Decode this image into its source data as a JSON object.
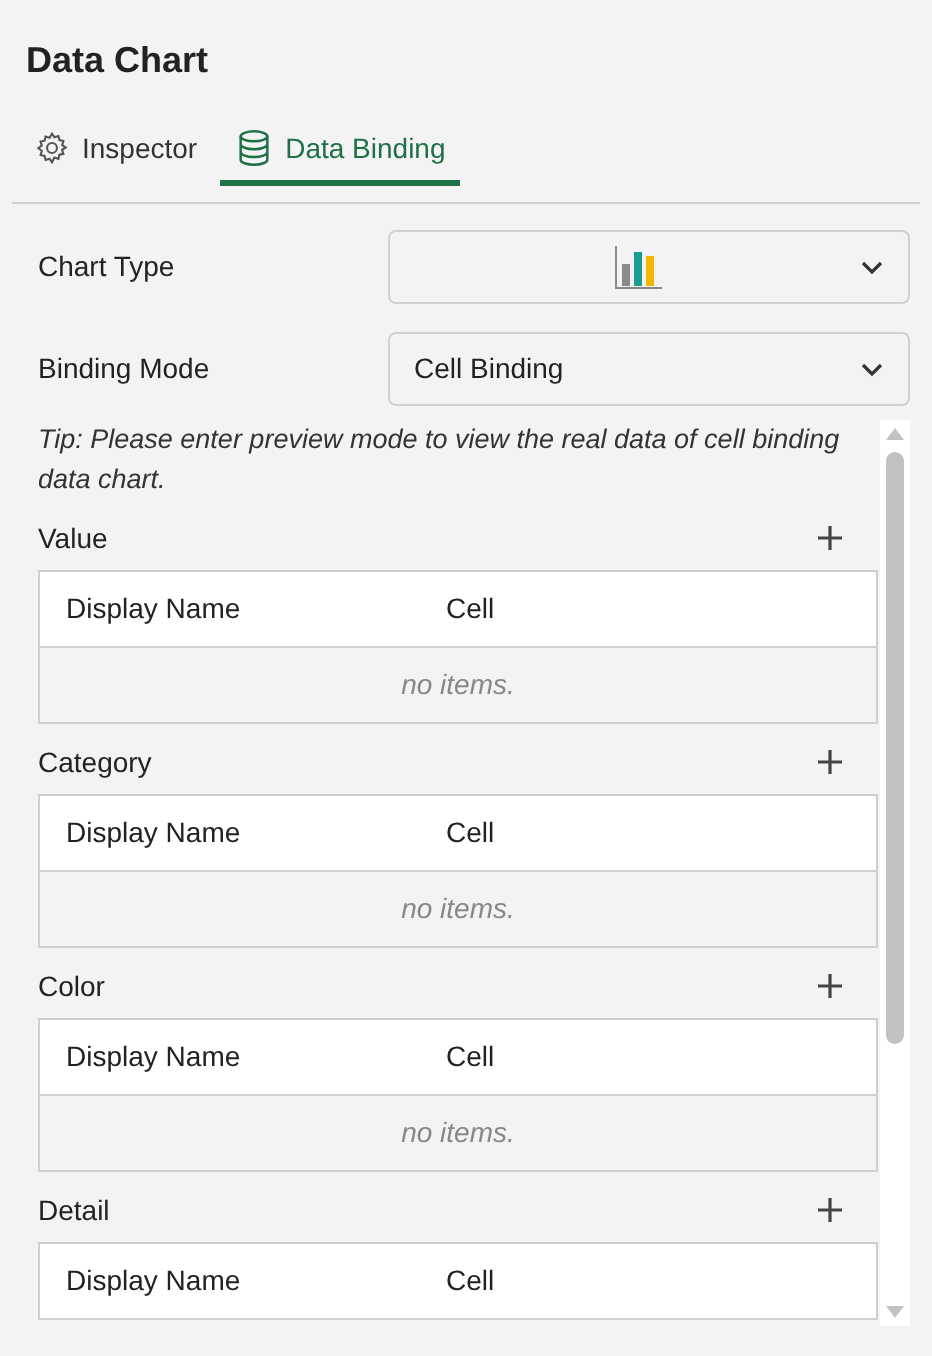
{
  "title": "Data Chart",
  "tabs": [
    {
      "label": "Inspector",
      "selected": false
    },
    {
      "label": "Data Binding",
      "selected": true
    }
  ],
  "fields": [
    {
      "label": "Chart Type",
      "kind": "chart"
    },
    {
      "label": "Binding Mode",
      "kind": "text",
      "value": "Cell Binding"
    }
  ],
  "tip": "Tip: Please enter preview mode to view the real data of cell binding data chart.",
  "sections": [
    {
      "name": "Value",
      "columns": [
        "Display Name",
        "Cell"
      ],
      "empty_text": "no items."
    },
    {
      "name": "Category",
      "columns": [
        "Display Name",
        "Cell"
      ],
      "empty_text": "no items."
    },
    {
      "name": "Color",
      "columns": [
        "Display Name",
        "Cell"
      ],
      "empty_text": "no items."
    },
    {
      "name": "Detail",
      "columns": [
        "Display Name",
        "Cell"
      ]
    }
  ]
}
